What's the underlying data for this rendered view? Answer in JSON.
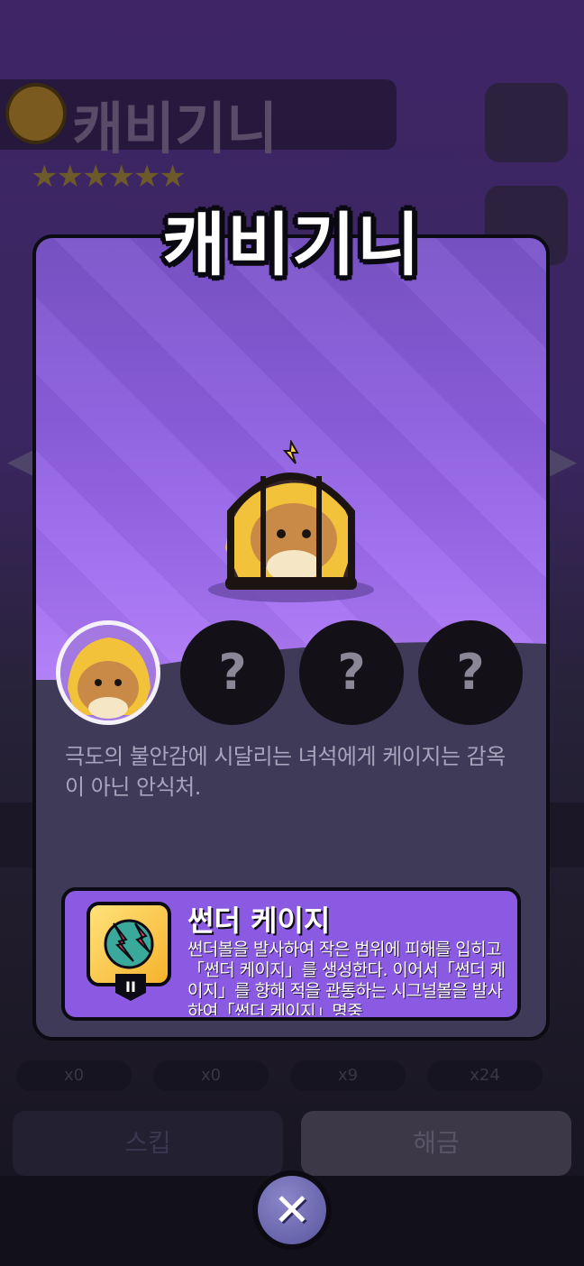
{
  "background": {
    "cookie_name": "캐비기니",
    "pill_counts": [
      "x0",
      "x0",
      "x9",
      "x24"
    ],
    "button_left_label": "스킵",
    "button_right_label": "해금"
  },
  "popup": {
    "title": "캐비기니",
    "description": "극도의 불안감에 시달리는 녀석에게 케이지는 감옥이 아닌 안식처.",
    "locked_portrait_symbol": "?",
    "skill": {
      "name": "썬더 케이지",
      "tier": "II",
      "description": "썬더볼을 발사하여 작은 범위에 피해를 입히고「썬더 케이지」를 생성한다. 이어서「썬더 케이지」를 향해 적을 관통하는 시그널볼을 발사하여「썬더 케이지」명중"
    },
    "close_symbol": "✕"
  },
  "colors": {
    "card_top": "#8e5fe0",
    "card_bottom": "#3f3a58",
    "skill_panel": "#8a5ae2",
    "close_button": "#6a66b0"
  }
}
